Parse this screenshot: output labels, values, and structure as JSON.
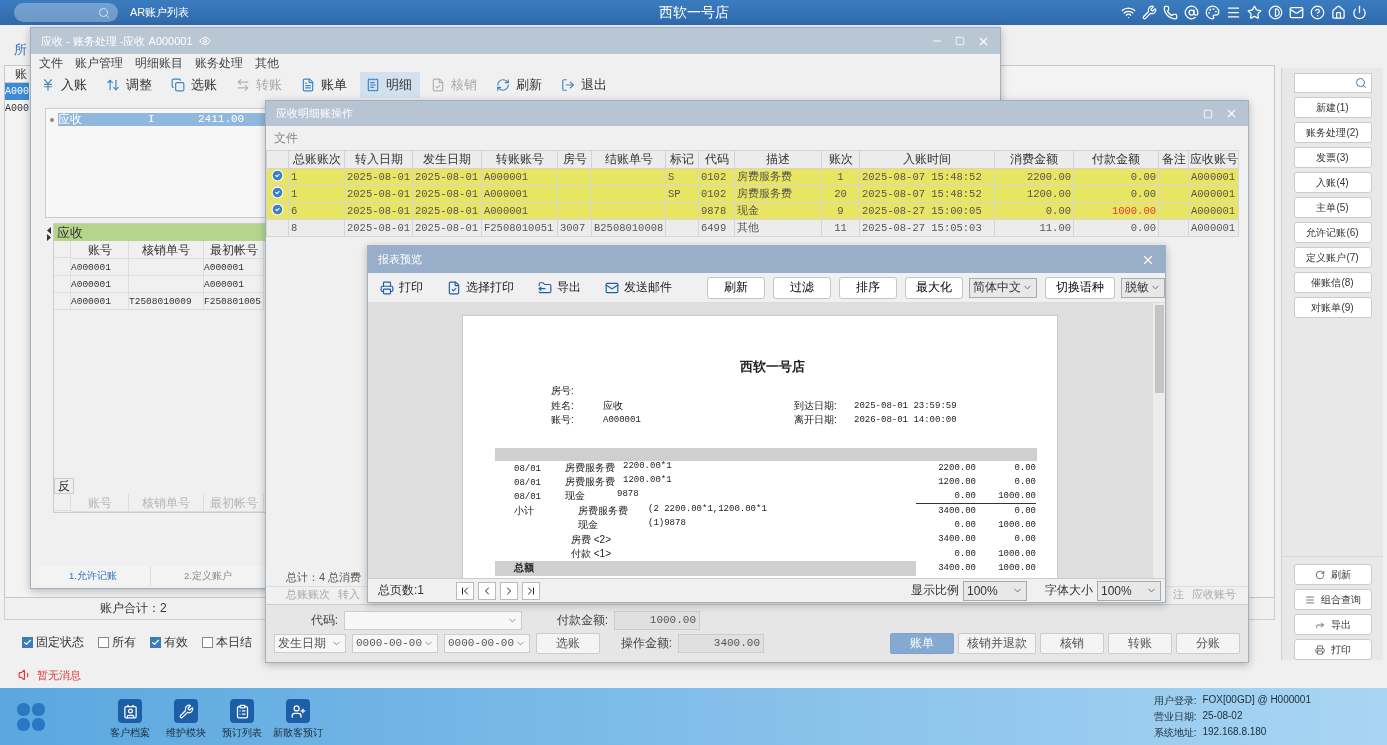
{
  "topbar": {
    "app_title": "AR账户列表",
    "store": "西软一号店"
  },
  "account_list": {
    "tab": "所",
    "column": "账",
    "rows": [
      {
        "text": "A000",
        "selected": true
      },
      {
        "text": "A000",
        "selected": false
      }
    ],
    "total": "账户合计：2"
  },
  "filters": [
    {
      "label": "固定状态",
      "checked": true
    },
    {
      "label": "所有",
      "checked": false
    },
    {
      "label": "有效",
      "checked": true
    },
    {
      "label": "本日结",
      "checked": false
    }
  ],
  "message": "暂无消息",
  "sidebar": {
    "actions": [
      "新建(1)",
      "账务处理(2)",
      "发票(3)",
      "入账(4)",
      "主单(5)",
      "允许记账(6)",
      "定义账户(7)",
      "催账信(8)",
      "对账单(9)"
    ],
    "tools": [
      "刷新",
      "组合查询",
      "导出",
      "打印"
    ]
  },
  "account_window": {
    "title": "应收 - 账务处理 -应收  A000001",
    "menu": [
      "文件",
      "账户管理",
      "明细账目",
      "账务处理",
      "其他"
    ],
    "toolbar": [
      {
        "label": "入账",
        "selected": false,
        "disabled": false
      },
      {
        "label": "调整",
        "selected": false,
        "disabled": false
      },
      {
        "label": "选账",
        "selected": false,
        "disabled": false
      },
      {
        "label": "转账",
        "selected": false,
        "disabled": true
      },
      {
        "label": "账单",
        "selected": false,
        "disabled": false
      },
      {
        "label": "明细",
        "selected": true,
        "disabled": false
      },
      {
        "label": "核销",
        "selected": false,
        "disabled": true
      },
      {
        "label": "刷新",
        "selected": false,
        "disabled": false
      },
      {
        "label": "退出",
        "selected": false,
        "disabled": false
      }
    ],
    "tree": [
      {
        "name": "应收",
        "type": "I",
        "amount": "2411.00",
        "selected": true
      }
    ],
    "ledger": {
      "title": "应收",
      "columns": [
        "账号",
        "核销单号",
        "最初帐号"
      ],
      "rows": [
        [
          "A000001",
          null,
          "A000001"
        ],
        [
          "A000001",
          null,
          "A000001"
        ],
        [
          "A000001",
          "T2508010009",
          "F250801005"
        ]
      ]
    },
    "reverse": {
      "title": "反",
      "columns": [
        "账号",
        "核销单号",
        "最初帐号"
      ]
    },
    "tabs": [
      {
        "label": "1.允许记账",
        "selected": true
      },
      {
        "label": "2.定义账户",
        "selected": false
      }
    ]
  },
  "detail_window": {
    "title": "应收明细账操作",
    "menu": [
      "文件"
    ],
    "columns": [
      "总账账次",
      "转入日期",
      "发生日期",
      "转账账号",
      "房号",
      "结账单号",
      "标记",
      "代码",
      "描述",
      "账次",
      "入账时间",
      "消费金额",
      "付款金额",
      "备注",
      "应收账号"
    ],
    "rows": [
      {
        "selected": true,
        "payment_flagged": false,
        "cells": [
          "1",
          "2025-08-01",
          "2025-08-01",
          "A000001",
          null,
          null,
          "S",
          "0102",
          "房费服务费",
          "1",
          "2025-08-07 15:48:52",
          "2200.00",
          "0.00",
          null,
          "A000001"
        ]
      },
      {
        "selected": true,
        "payment_flagged": false,
        "cells": [
          "1",
          "2025-08-01",
          "2025-08-01",
          "A000001",
          null,
          null,
          "SP",
          "0102",
          "房费服务费",
          "20",
          "2025-08-07 15:48:52",
          "1200.00",
          "0.00",
          null,
          "A000001"
        ]
      },
      {
        "selected": true,
        "payment_flagged": true,
        "cells": [
          "6",
          "2025-08-01",
          "2025-08-01",
          "A000001",
          null,
          null,
          null,
          "9878",
          "现金",
          "9",
          "2025-08-27 15:00:05",
          "0.00",
          "1000.00",
          null,
          "A000001"
        ]
      },
      {
        "selected": false,
        "payment_flagged": false,
        "cells": [
          "8",
          "2025-08-01",
          "2025-08-01",
          "F2508010051",
          "3007",
          "B2508010008",
          null,
          "6499",
          "其他",
          "11",
          "2025-08-27 15:05:03",
          "11.00",
          "0.00",
          null,
          "A000001"
        ]
      }
    ],
    "summary": "总计：4 总消费",
    "footer_columns_left": [
      "总账账次",
      "转入"
    ],
    "footer_columns_right": [
      "注",
      "应收账号"
    ],
    "form": {
      "code_label": "代码:",
      "payment_label": "付款金额:",
      "payment_value": "1000.00",
      "date_type": "发生日期",
      "date_from": "0000-00-00",
      "date_to": "0000-00-00",
      "select_button": "选账",
      "operation_label": "操作金额:",
      "operation_value": "3400.00"
    },
    "buttons": [
      {
        "label": "账单",
        "primary": true
      },
      {
        "label": "核销并退款",
        "primary": false
      },
      {
        "label": "核销",
        "primary": false
      },
      {
        "label": "转账",
        "primary": false
      },
      {
        "label": "分账",
        "primary": false
      }
    ]
  },
  "report_window": {
    "title": "报表预览",
    "toolbar": [
      "打印",
      "选择打印",
      "导出",
      "发送邮件"
    ],
    "buttons": [
      "刷新",
      "过滤",
      "排序",
      "最大化"
    ],
    "language": "简体中文",
    "switch_button": "切换语种",
    "masking": "脱敏",
    "report": {
      "title": "西软一号店",
      "left_fields": [
        {
          "label": "房号:"
        },
        {
          "label": "姓名:",
          "value": "应收"
        },
        {
          "label": "账号:",
          "value": "A000001"
        }
      ],
      "right_fields": [
        {
          "label": "到达日期:",
          "value": "2025-08-01 23:59:59"
        },
        {
          "label": "离开日期:",
          "value": "2026-08-01 14:00:00"
        }
      ],
      "lines": [
        {
          "kind": "entry",
          "date": "08/01",
          "item": "房费服务费",
          "detail": "2200.00*1",
          "amount": "2200.00",
          "payment": "0.00"
        },
        {
          "kind": "entry",
          "date": "08/01",
          "item": "房费服务费",
          "detail": "1200.00*1",
          "amount": "1200.00",
          "payment": "0.00"
        },
        {
          "kind": "entry",
          "date": "08/01",
          "item": "现金",
          "detail": "9878",
          "amount": "0.00",
          "payment": "1000.00"
        },
        {
          "kind": "subtotal",
          "date": "小计",
          "item": "房费服务费",
          "detail": "(2 2200.00*1,1200.00*1",
          "amount": "3400.00",
          "payment": "0.00"
        },
        {
          "kind": "subtotal",
          "item": "现金",
          "detail": "(1)9878",
          "amount": "0.00",
          "payment": "1000.00"
        },
        {
          "kind": "group",
          "item": "房费 <2>",
          "amount": "3400.00",
          "payment": "0.00"
        },
        {
          "kind": "group",
          "item": "付款 <1>",
          "amount": "0.00",
          "payment": "1000.00"
        },
        {
          "kind": "total",
          "date": "总额",
          "amount": "3400.00",
          "payment": "1000.00"
        }
      ]
    },
    "pages": "总页数:1",
    "zoom_label": "显示比例",
    "zoom": "100%",
    "font_label": "字体大小",
    "font_size": "100%"
  },
  "taskbar": {
    "apps": [
      "客户档案",
      "维护模块",
      "预订列表",
      "新散客预订"
    ],
    "status": [
      {
        "label": "用户登录:",
        "value": "FOX[00GD] @ H000001"
      },
      {
        "label": "营业日期:",
        "value": "25-08-02"
      },
      {
        "label": "系统地址:",
        "value": "192.168.8.180"
      }
    ]
  }
}
